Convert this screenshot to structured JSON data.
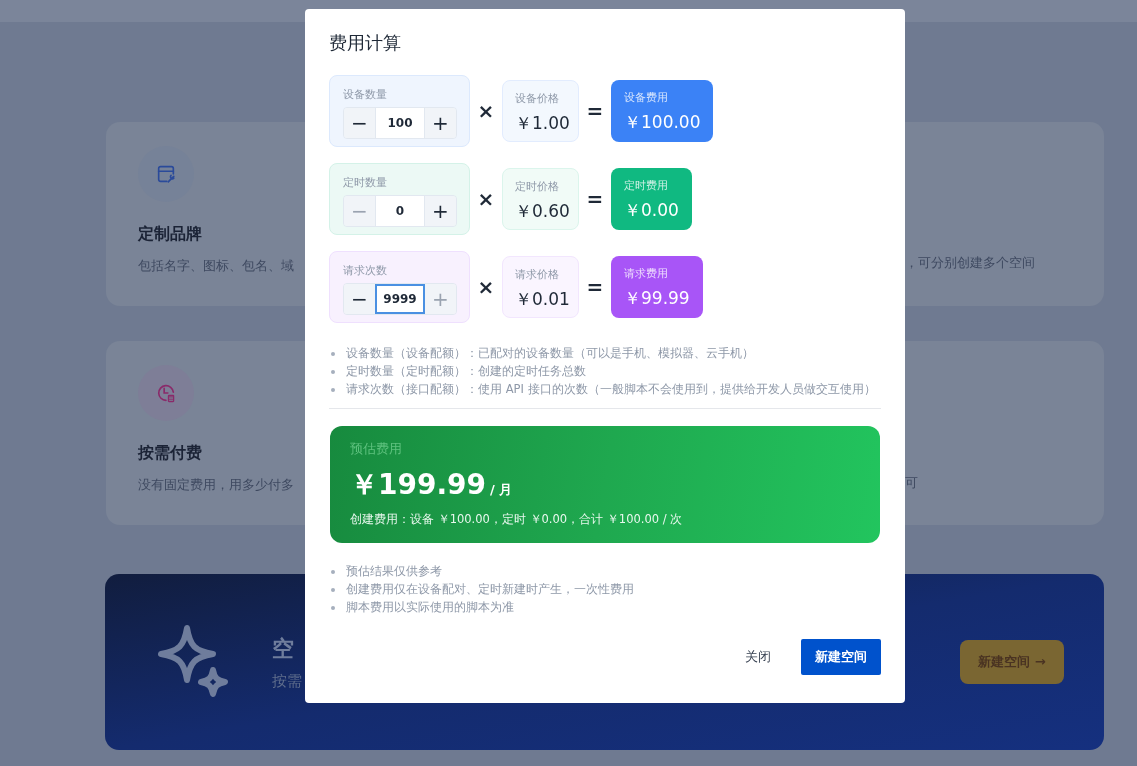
{
  "page": {
    "feature_cards": [
      {
        "title": "定制品牌",
        "description": "包括名字、图标、包名、域"
      },
      {
        "description": "，可分别创建多个空间"
      },
      {
        "title": "按需付费",
        "description": "没有固定费用，用多少付多"
      },
      {
        "description": "可"
      }
    ],
    "banner": {
      "title": "空",
      "subtitle": "按需",
      "button": "新建空间 →"
    }
  },
  "dialog": {
    "title": "费用计算",
    "rows": [
      {
        "color": "#3b82f6",
        "quantity_label": "设备数量",
        "minus": "−",
        "value": "100",
        "plus": "+",
        "minus_disabled": false,
        "plus_disabled": false,
        "focused": false,
        "times": "×",
        "price_label": "设备价格",
        "price": "￥1.00",
        "equals": "=",
        "cost_label": "设备费用",
        "cost": "￥100.00"
      },
      {
        "color": "#10b981",
        "quantity_label": "定时数量",
        "minus": "−",
        "value": "0",
        "plus": "+",
        "minus_disabled": true,
        "plus_disabled": false,
        "focused": false,
        "times": "×",
        "price_label": "定时价格",
        "price": "￥0.60",
        "equals": "=",
        "cost_label": "定时费用",
        "cost": "￥0.00"
      },
      {
        "color": "#a855f7",
        "quantity_label": "请求次数",
        "minus": "−",
        "value": "9999",
        "plus": "+",
        "minus_disabled": false,
        "plus_disabled": true,
        "focused": true,
        "times": "×",
        "price_label": "请求价格",
        "price": "￥0.01",
        "equals": "=",
        "cost_label": "请求费用",
        "cost": "￥99.99"
      }
    ],
    "notes": [
      "设备数量（设备配额）：已配对的设备数量（可以是手机、模拟器、云手机）",
      "定时数量（定时配额）：创建的定时任务总数",
      "请求次数（接口配额）：使用 API 接口的次数（一般脚本不会使用到，提供给开发人员做交互使用）"
    ],
    "estimate": {
      "label": "预估费用",
      "amount": "￥199.99",
      "unit": "/ 月",
      "creation_fee": "创建费用：设备 ￥100.00，定时 ￥0.00，合计 ￥100.00 / 次"
    },
    "footnotes": [
      "预估结果仅供参考",
      "创建费用仅在设备配对、定时新建时产生，一次性费用",
      "脚本费用以实际使用的脚本为准"
    ],
    "buttons": [
      {
        "label": "关闭",
        "kind": "text"
      },
      {
        "label": "新建空间",
        "kind": "primary"
      }
    ]
  }
}
